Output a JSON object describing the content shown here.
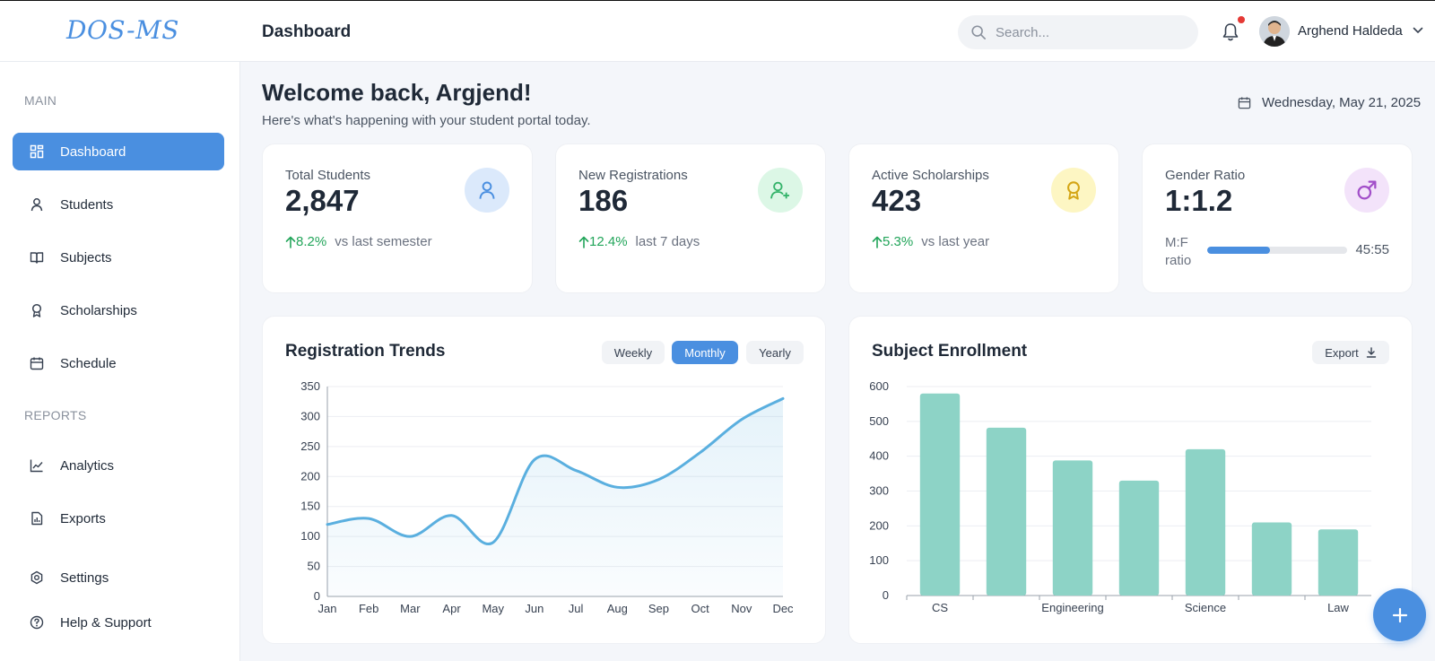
{
  "app": {
    "logo": "DOS-MS",
    "page_title": "Dashboard"
  },
  "header": {
    "search_placeholder": "Search...",
    "user_name": "Arghend Haldeda"
  },
  "sidebar": {
    "main_label": "MAIN",
    "reports_label": "REPORTS",
    "main_items": [
      {
        "label": "Dashboard",
        "icon": "grid-icon",
        "active": true
      },
      {
        "label": "Students",
        "icon": "user-icon"
      },
      {
        "label": "Subjects",
        "icon": "book-icon"
      },
      {
        "label": "Scholarships",
        "icon": "award-icon"
      },
      {
        "label": "Schedule",
        "icon": "calendar-icon"
      }
    ],
    "report_items": [
      {
        "label": "Analytics",
        "icon": "chart-line-icon"
      },
      {
        "label": "Exports",
        "icon": "file-chart-icon"
      }
    ],
    "bottom_items": [
      {
        "label": "Settings",
        "icon": "gear-icon"
      },
      {
        "label": "Help & Support",
        "icon": "help-icon"
      }
    ]
  },
  "welcome": {
    "title": "Welcome back, Argjend!",
    "subtitle": "Here's what's happening with your student portal today.",
    "date": "Wednesday, May 21, 2025"
  },
  "stats": [
    {
      "label": "Total Students",
      "value": "2,847",
      "change": "8.2%",
      "period": "vs last semester",
      "icon": "user-icon",
      "icon_bg": "#dbe9fb",
      "icon_color": "#4a8fe0"
    },
    {
      "label": "New Registrations",
      "value": "186",
      "change": "12.4%",
      "period": "last 7 days",
      "icon": "user-plus-icon",
      "icon_bg": "#dcf7e6",
      "icon_color": "#34b36a"
    },
    {
      "label": "Active Scholarships",
      "value": "423",
      "change": "5.3%",
      "period": "vs last year",
      "icon": "award-icon",
      "icon_bg": "#fdf6c3",
      "icon_color": "#d4a514"
    },
    {
      "label": "Gender Ratio",
      "value": "1:1.2",
      "ratio_label": "M:F ratio",
      "ratio_text": "45:55",
      "ratio_fraction": 0.45,
      "icon": "male-icon",
      "icon_bg": "#f3e3fa",
      "icon_color": "#a24fc9"
    }
  ],
  "registration_chart": {
    "title": "Registration Trends",
    "buttons": [
      "Weekly",
      "Monthly",
      "Yearly"
    ],
    "active_button": "Monthly"
  },
  "enrollment_chart": {
    "title": "Subject Enrollment",
    "export_label": "Export"
  },
  "colors": {
    "accent": "#4a8fe0",
    "line": "#5aafdf",
    "bar": "#8dd3c6",
    "positive": "#22a55a"
  },
  "chart_data": [
    {
      "type": "line",
      "x": [
        "Jan",
        "Feb",
        "Mar",
        "Apr",
        "May",
        "Jun",
        "Jul",
        "Aug",
        "Sep",
        "Oct",
        "Nov",
        "Dec"
      ],
      "series": [
        {
          "values": [
            120,
            130,
            100,
            135,
            90,
            228,
            210,
            182,
            195,
            240,
            295,
            330
          ]
        }
      ],
      "ylim": [
        0,
        350
      ],
      "yticks": [
        0,
        50,
        100,
        150,
        200,
        250,
        300,
        350
      ],
      "grid": true,
      "area_fill": true
    },
    {
      "type": "bar",
      "categories": [
        "CS",
        "",
        "Engineering",
        "",
        "Science",
        "",
        "Law"
      ],
      "values": [
        580,
        482,
        388,
        330,
        420,
        210,
        190
      ],
      "ylim": [
        0,
        600
      ],
      "yticks": [
        0,
        100,
        200,
        300,
        400,
        500,
        600
      ],
      "grid": true
    }
  ]
}
